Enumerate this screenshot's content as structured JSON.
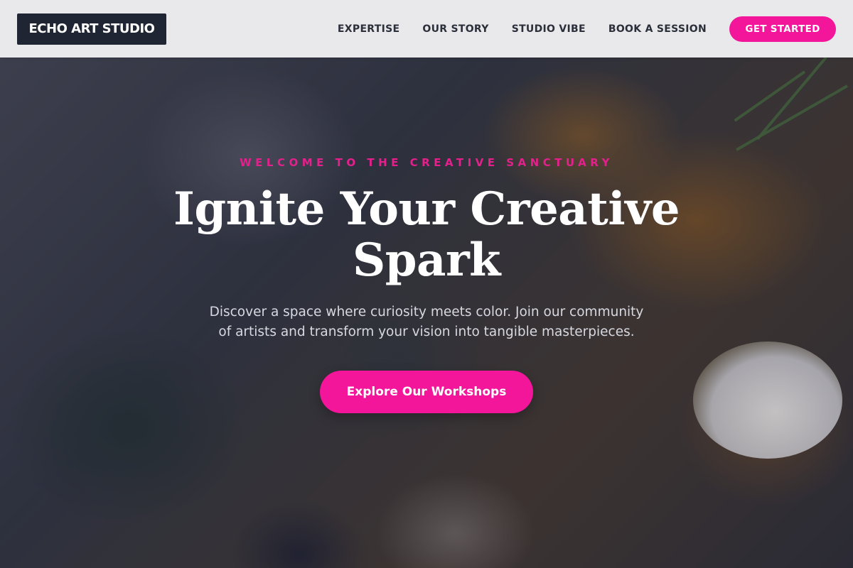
{
  "header": {
    "logo_text": "ECHO ART STUDIO",
    "nav": [
      {
        "label": "EXPERTISE"
      },
      {
        "label": "OUR STORY"
      },
      {
        "label": "STUDIO VIBE"
      },
      {
        "label": "BOOK A SESSION"
      }
    ],
    "cta_label": "GET STARTED"
  },
  "hero": {
    "eyebrow": "WELCOME TO THE CREATIVE SANCTUARY",
    "title_line1": "Ignite Your Creative",
    "title_line2": "Spark",
    "subtitle_line1": "Discover a space where curiosity meets color. Join our community",
    "subtitle_line2": "of artists and transform your vision into tangible masterpieces.",
    "button_label": "Explore Our Workshops"
  },
  "colors": {
    "accent": "#f3169a",
    "logo_bg": "#1f2533",
    "header_bg": "#f0f0f2"
  }
}
